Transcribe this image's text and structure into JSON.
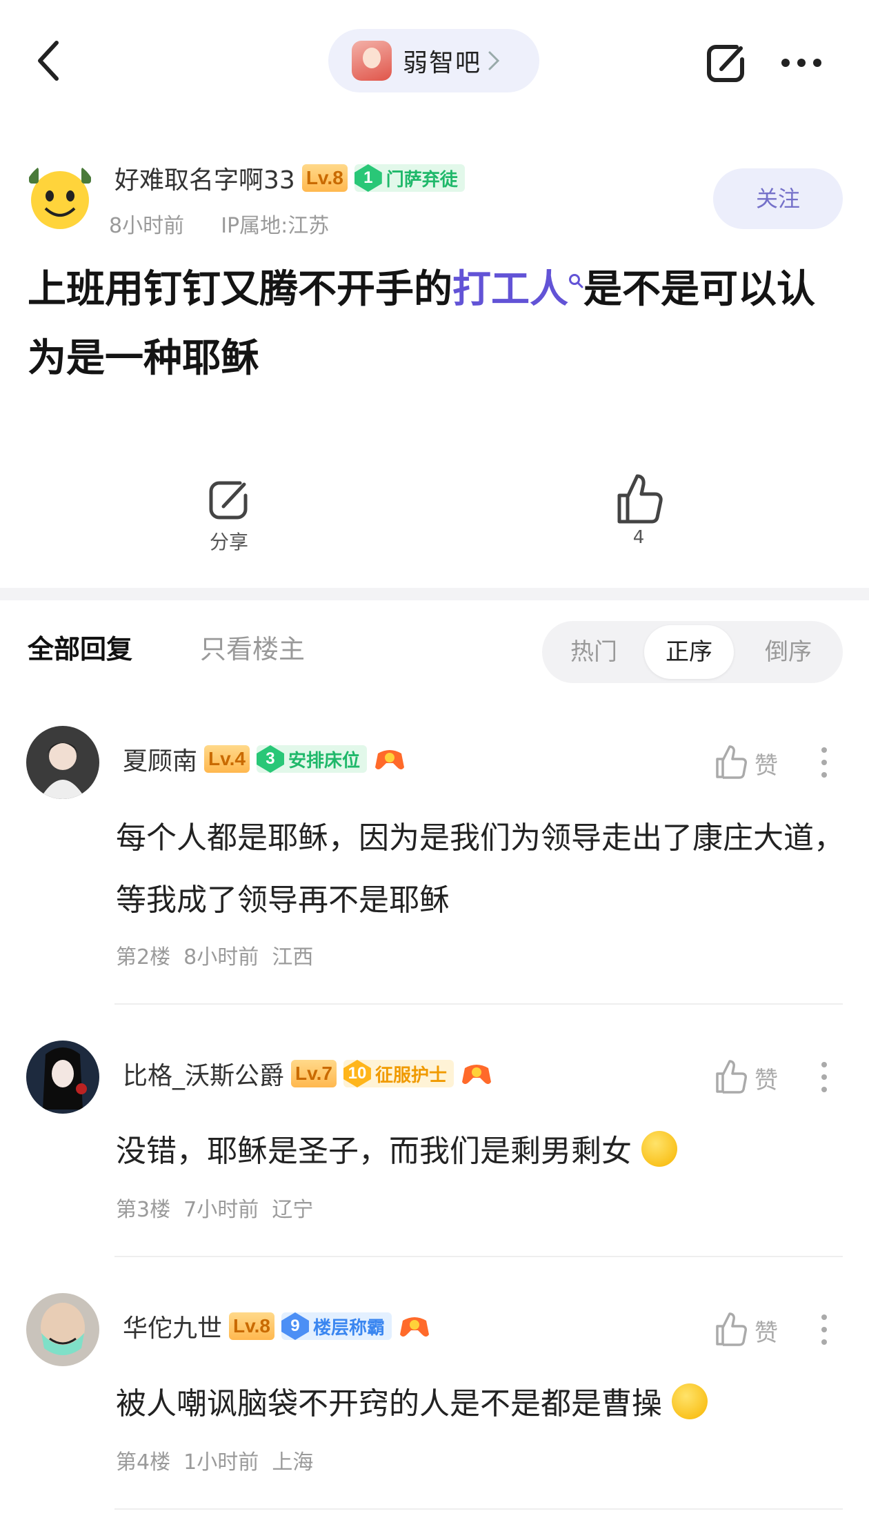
{
  "topbar": {
    "forum_name": "弱智吧"
  },
  "post": {
    "author": "好难取名字啊33",
    "level": "Lv.8",
    "badge_num": "1",
    "badge_text": "门萨弃徒",
    "time": "8小时前",
    "ip": "IP属地:江苏",
    "follow_label": "关注",
    "title_pre": "上班用钉钉又腾不开手的",
    "title_link": "打工人",
    "title_post": "是不是可以认为是一种耶稣",
    "share_label": "分享",
    "like_count": "4"
  },
  "tabs": {
    "all": "全部回复",
    "op_only": "只看楼主",
    "sort": [
      "热门",
      "正序",
      "倒序"
    ],
    "active_sort": "正序"
  },
  "comments": [
    {
      "name": "夏顾南",
      "level": "Lv.4",
      "badge_num": "3",
      "badge_text": "安排床位",
      "badge_color": "green",
      "body": "每个人都是耶稣，因为是我们为领导走出了康庄大道，等我成了领导再不是耶稣",
      "floor": "第2楼",
      "time": "8小时前",
      "location": "江西",
      "like_label": "赞"
    },
    {
      "name": "比格_沃斯公爵",
      "level": "Lv.7",
      "badge_num": "10",
      "badge_text": "征服护士",
      "badge_color": "yellow",
      "body": "没错，耶稣是圣子，而我们是剩男剩女",
      "floor": "第3楼",
      "time": "7小时前",
      "location": "辽宁",
      "like_label": "赞"
    },
    {
      "name": "华佗九世",
      "level": "Lv.8",
      "badge_num": "9",
      "badge_text": "楼层称霸",
      "badge_color": "blue",
      "body": "被人嘲讽脑袋不开窍的人是不是都是曹操",
      "floor": "第4楼",
      "time": "1小时前",
      "location": "上海",
      "like_label": "赞"
    }
  ],
  "colors": {
    "accent": "#6253d6",
    "follow_bg": "#eceefb",
    "pill_bg": "#eef0fb"
  }
}
